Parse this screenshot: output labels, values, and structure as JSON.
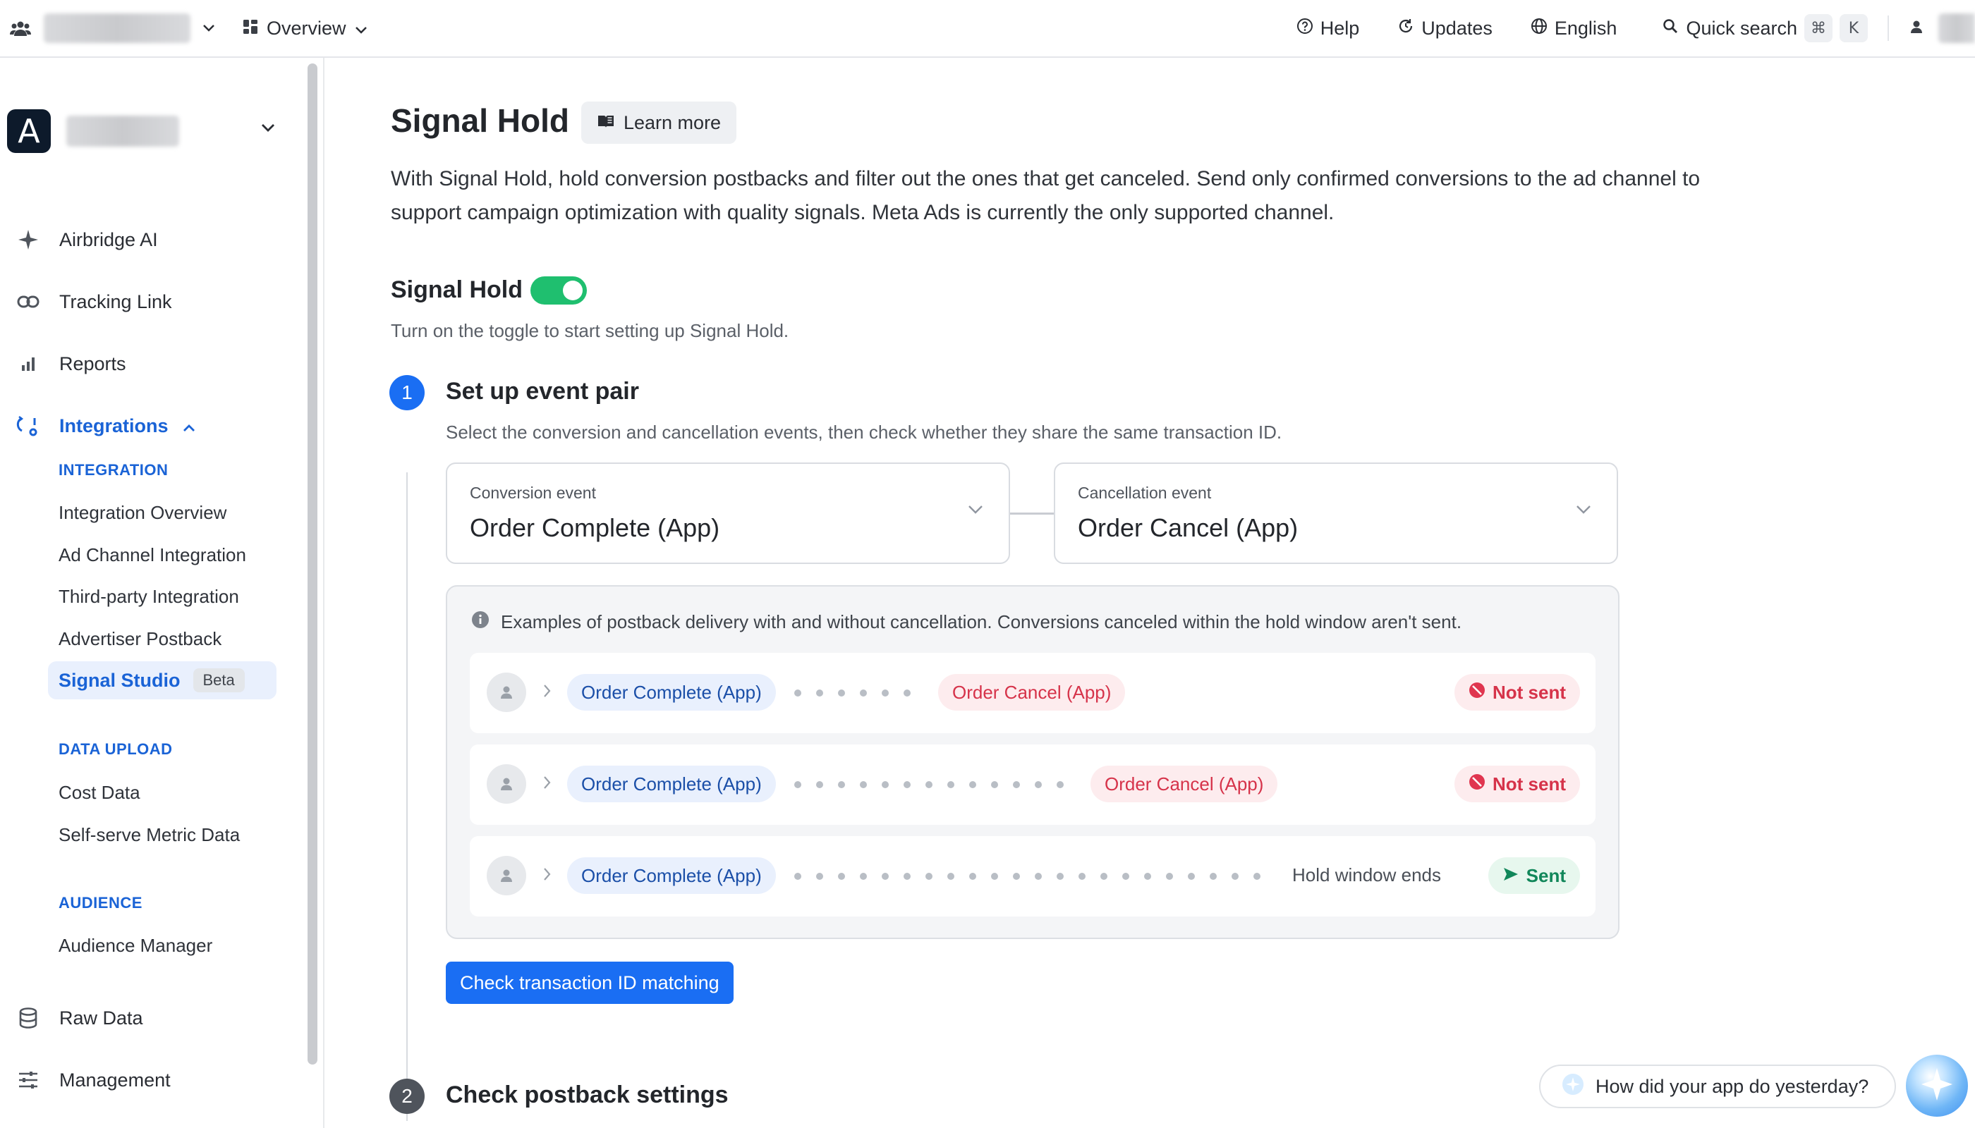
{
  "topbar": {
    "overview_label": "Overview",
    "help_label": "Help",
    "updates_label": "Updates",
    "language_label": "English",
    "quick_search_label": "Quick search",
    "shortcut_key_1": "⌘",
    "shortcut_key_2": "K"
  },
  "sidebar": {
    "app_logo_letter": "A",
    "airbridge_ai": "Airbridge AI",
    "tracking_link": "Tracking Link",
    "reports": "Reports",
    "integrations": "Integrations",
    "group_integration": "INTEGRATION",
    "integration_overview": "Integration Overview",
    "ad_channel_integration": "Ad Channel Integration",
    "third_party_integration": "Third-party Integration",
    "advertiser_postback": "Advertiser Postback",
    "signal_studio": "Signal Studio",
    "beta_badge": "Beta",
    "group_data_upload": "DATA UPLOAD",
    "cost_data": "Cost Data",
    "self_serve_metric": "Self-serve Metric Data",
    "group_audience": "AUDIENCE",
    "audience_manager": "Audience Manager",
    "raw_data": "Raw Data",
    "management": "Management"
  },
  "main": {
    "title": "Signal Hold",
    "learn_more": "Learn more",
    "description": "With Signal Hold, hold conversion postbacks and filter out the ones that get canceled. Send only confirmed conversions to the ad channel to support campaign optimization with quality signals. Meta Ads is currently the only supported channel.",
    "toggle_label": "Signal Hold",
    "toggle_on": true,
    "toggle_help": "Turn on the toggle to start setting up Signal Hold.",
    "step1": {
      "number": "1",
      "title": "Set up event pair",
      "description": "Select the conversion and cancellation events, then check whether they share the same transaction ID.",
      "conversion_label": "Conversion event",
      "conversion_value": "Order Complete (App)",
      "cancellation_label": "Cancellation event",
      "cancellation_value": "Order Cancel (App)"
    },
    "examples": {
      "note": "Examples of postback delivery with and without cancellation. Conversions canceled within the hold window aren't sent.",
      "rows": [
        {
          "conversion": "Order Complete (App)",
          "cancel": "Order Cancel (App)",
          "status": "Not sent"
        },
        {
          "conversion": "Order Complete (App)",
          "cancel": "Order Cancel (App)",
          "status": "Not sent"
        },
        {
          "conversion": "Order Complete (App)",
          "hold_end": "Hold window ends",
          "status": "Sent"
        }
      ]
    },
    "check_button": "Check transaction ID matching",
    "step2": {
      "number": "2",
      "title": "Check postback settings"
    }
  },
  "chat_prompt": "How did your app do yesterday?",
  "colors": {
    "accent": "#1a6ef3",
    "toggle_on": "#1fbf6f",
    "not_sent": "#d6334a",
    "sent": "#11875a"
  }
}
